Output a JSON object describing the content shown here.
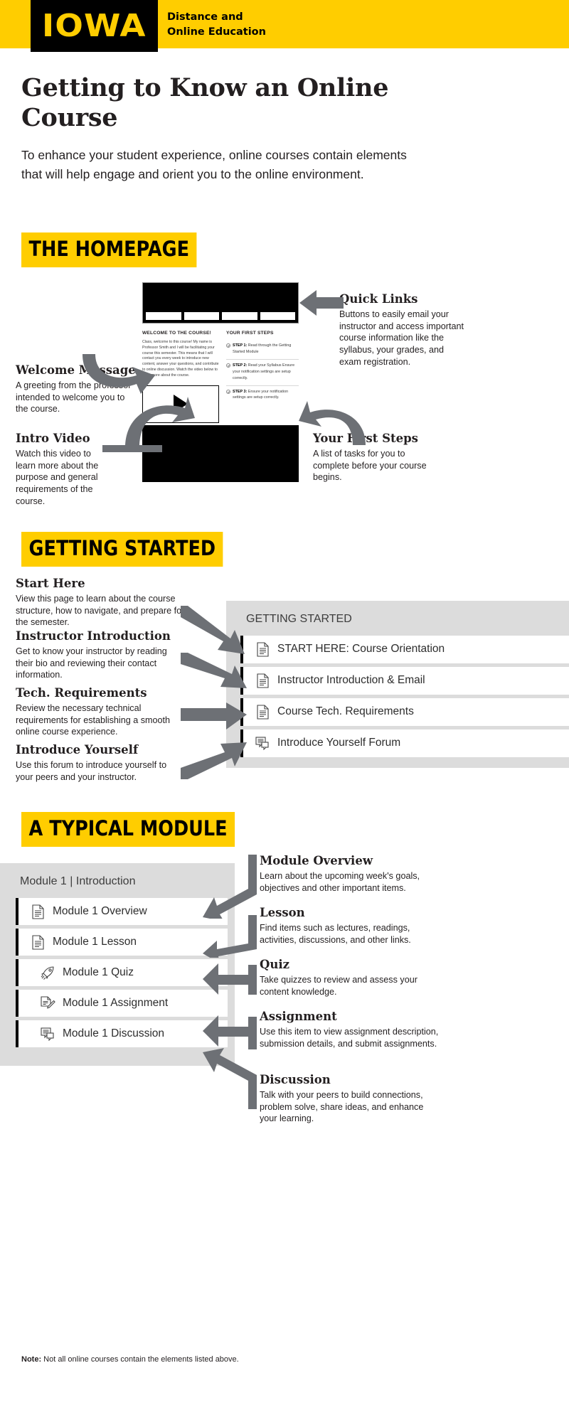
{
  "header": {
    "logo_text": "IOWA",
    "subtitle_line1": "Distance and",
    "subtitle_line2": "Online Education",
    "brand_yellow": "#ffcd00",
    "brand_black": "#000000"
  },
  "page": {
    "title": "Getting to Know an Online Course",
    "intro": "To enhance your student experience, online courses contain elements that will help engage and orient you to the online environment."
  },
  "sections": {
    "homepage": {
      "banner": "THE HOMEPAGE"
    },
    "getting_started": {
      "banner": "GETTING STARTED"
    },
    "module": {
      "banner": "A TYPICAL MODULE"
    }
  },
  "homepage_annotations": {
    "welcome": {
      "title": "Welcome Message",
      "body": "A greeting from the professor intended to welcome you to the course."
    },
    "intro_video": {
      "title": "Intro Video",
      "body": "Watch this video to learn more about the purpose and general requirements of the course."
    },
    "quick_links": {
      "title": "Quick Links",
      "body": "Buttons to easily email your instructor and access important course information like the syllabus, your grades, and exam registration."
    },
    "first_steps": {
      "title": "Your First Steps",
      "body": "A list of tasks for you to complete before your course begins."
    }
  },
  "homepage_mock": {
    "welcome_heading": "WELCOME TO THE COURSE!",
    "welcome_body": "Class, welcome to this course! My name is Professor Smith and I will be facilitating your course this semester. This means that I will contact you every week to introduce new content, answer your questions, and contribute to online discussion. Watch the video below to learn more about the course.",
    "steps_heading": "YOUR FIRST STEPS",
    "steps": [
      {
        "label": "STEP 1:",
        "text": " Read through the Getting Started Module"
      },
      {
        "label": "STEP 2:",
        "text": " Read your Syllabus Ensure your notification settings are setup correctly."
      },
      {
        "label": "STEP 3:",
        "text": " Ensure your notification settings are setup correctly."
      }
    ]
  },
  "getting_started_annotations": [
    {
      "title": "Start Here",
      "body": "View this page to learn about the course structure, how to navigate, and prepare for the semester."
    },
    {
      "title": "Instructor Introduction",
      "body": "Get to know your instructor by reading their bio and reviewing their contact information."
    },
    {
      "title": "Tech. Requirements",
      "body": "Review the necessary technical requirements for establishing a smooth online course experience."
    },
    {
      "title": "Introduce Yourself",
      "body": "Use this forum to introduce yourself to your peers and your instructor."
    }
  ],
  "getting_started_panel": {
    "title": "GETTING STARTED",
    "items": [
      {
        "icon": "document-icon",
        "label": "START HERE: Course Orientation"
      },
      {
        "icon": "document-icon",
        "label": "Instructor Introduction & Email"
      },
      {
        "icon": "document-icon",
        "label": "Course Tech. Requirements"
      },
      {
        "icon": "discussion-icon",
        "label": "Introduce Yourself Forum"
      }
    ]
  },
  "module_panel": {
    "title": "Module 1 | Introduction",
    "items": [
      {
        "icon": "document-icon",
        "label": "Module 1 Overview"
      },
      {
        "icon": "document-icon",
        "label": "Module 1 Lesson"
      },
      {
        "icon": "rocket-icon",
        "label": "Module 1 Quiz"
      },
      {
        "icon": "assignment-icon",
        "label": "Module 1 Assignment"
      },
      {
        "icon": "discussion-icon",
        "label": "Module 1 Discussion"
      }
    ]
  },
  "module_annotations": [
    {
      "title": "Module Overview",
      "body": "Learn about the upcoming week's goals, objectives and other important items."
    },
    {
      "title": "Lesson",
      "body": "Find items such as lectures, readings, activities, discussions, and other links."
    },
    {
      "title": "Quiz",
      "body": "Take quizzes to review and assess your content knowledge."
    },
    {
      "title": "Assignment",
      "body": "Use this item to view assignment description, submission details, and submit assignments."
    },
    {
      "title": "Discussion",
      "body": "Talk with your peers to build connections, problem solve, share ideas, and enhance your learning."
    }
  ],
  "footnote": {
    "label": "Note:",
    "text": " Not all online courses contain the elements listed above."
  }
}
